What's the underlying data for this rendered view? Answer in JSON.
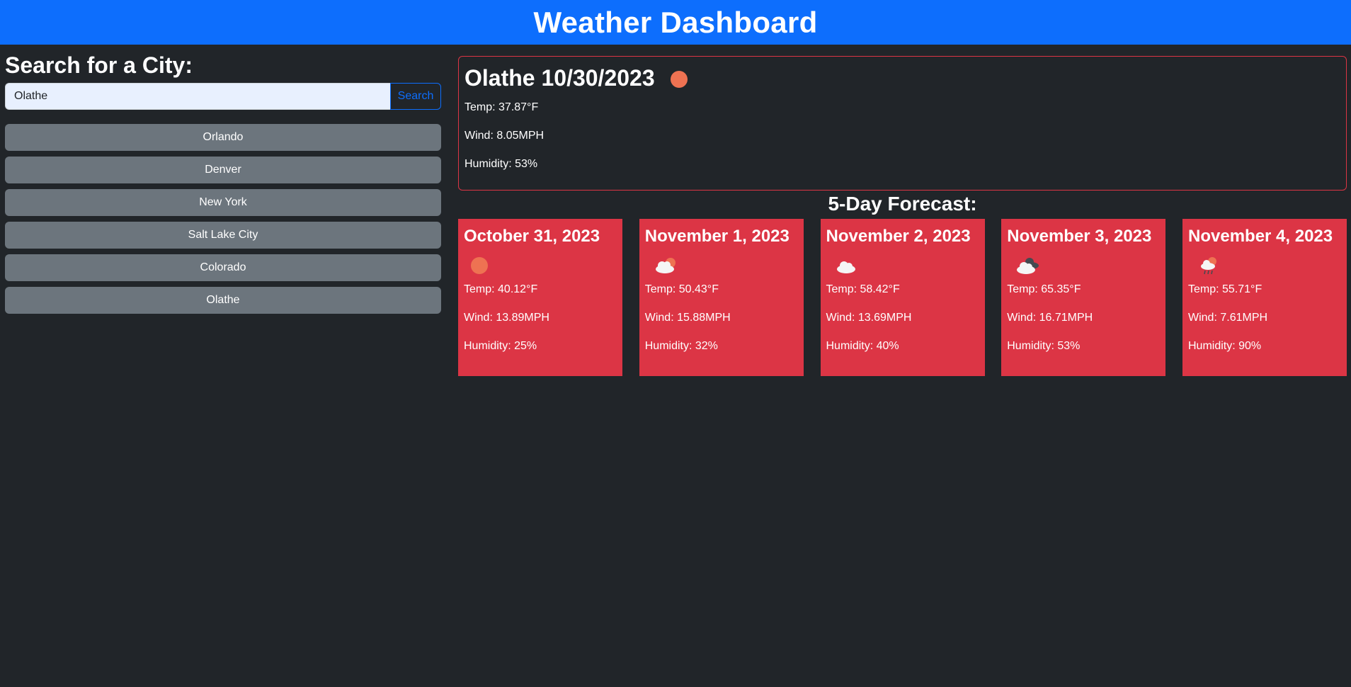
{
  "header": {
    "title": "Weather Dashboard"
  },
  "search": {
    "heading": "Search for a City:",
    "input_value": "Olathe",
    "button_label": "Search"
  },
  "history": [
    "Orlando",
    "Denver",
    "New York",
    "Salt Lake City",
    "Colorado",
    "Olathe"
  ],
  "current": {
    "title": "Olathe 10/30/2023",
    "icon": "clear-sun-icon",
    "temp": "Temp: 37.87°F",
    "wind": "Wind: 8.05MPH",
    "humidity": "Humidity: 53%"
  },
  "forecast": {
    "heading": "5-Day Forecast:",
    "days": [
      {
        "date": "October 31, 2023",
        "icon": "clear-sun-icon",
        "temp": "Temp: 40.12°F",
        "wind": "Wind: 13.89MPH",
        "humidity": "Humidity: 25%"
      },
      {
        "date": "November 1, 2023",
        "icon": "few-clouds-icon",
        "temp": "Temp: 50.43°F",
        "wind": "Wind: 15.88MPH",
        "humidity": "Humidity: 32%"
      },
      {
        "date": "November 2, 2023",
        "icon": "cloud-icon",
        "temp": "Temp: 58.42°F",
        "wind": "Wind: 13.69MPH",
        "humidity": "Humidity: 40%"
      },
      {
        "date": "November 3, 2023",
        "icon": "broken-clouds-icon",
        "temp": "Temp: 65.35°F",
        "wind": "Wind: 16.71MPH",
        "humidity": "Humidity: 53%"
      },
      {
        "date": "November 4, 2023",
        "icon": "rain-icon",
        "temp": "Temp: 55.71°F",
        "wind": "Wind: 7.61MPH",
        "humidity": "Humidity: 90%"
      }
    ]
  },
  "colors": {
    "header_bg": "#0d6efd",
    "page_bg": "#212529",
    "history_button_bg": "#6c757d",
    "card_bg": "#dc3545",
    "sun": "#ee7252"
  }
}
